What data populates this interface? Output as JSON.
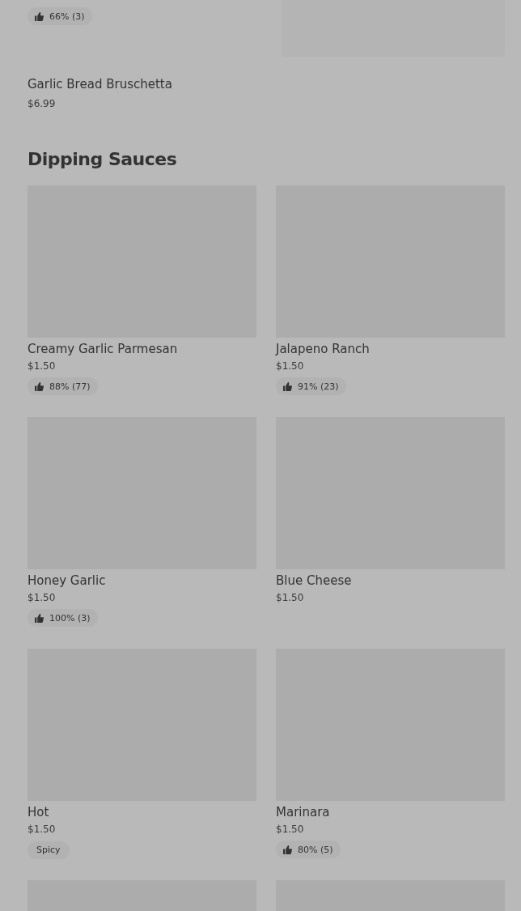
{
  "top_items": [
    {
      "badge": {
        "kind": "rating",
        "text": "66% (3)"
      }
    }
  ],
  "previous_item": {
    "name": "Garlic Bread Bruschetta",
    "price": "$6.99"
  },
  "section": {
    "title": "Dipping Sauces",
    "items": [
      {
        "name": "Creamy Garlic Parmesan",
        "price": "$1.50",
        "badge": {
          "kind": "rating",
          "text": "88% (77)"
        }
      },
      {
        "name": "Jalapeno Ranch",
        "price": "$1.50",
        "badge": {
          "kind": "rating",
          "text": "91% (23)"
        }
      },
      {
        "name": "Honey Garlic",
        "price": "$1.50",
        "badge": {
          "kind": "rating",
          "text": "100% (3)"
        }
      },
      {
        "name": "Blue Cheese",
        "price": "$1.50"
      },
      {
        "name": "Hot",
        "price": "$1.50",
        "badge": {
          "kind": "tag",
          "text": "Spicy"
        }
      },
      {
        "name": "Marinara",
        "price": "$1.50",
        "badge": {
          "kind": "rating",
          "text": "80% (5)"
        }
      }
    ]
  }
}
